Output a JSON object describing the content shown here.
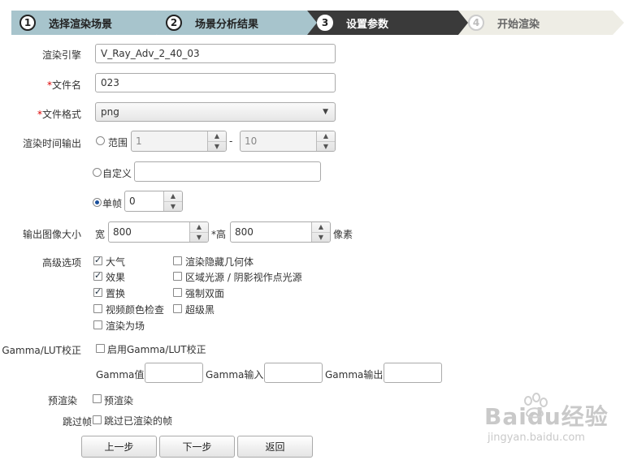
{
  "steps": [
    {
      "num": "1",
      "label": "选择渲染场景"
    },
    {
      "num": "2",
      "label": "场景分析结果"
    },
    {
      "num": "3",
      "label": "设置参数"
    },
    {
      "num": "4",
      "label": "开始渲染"
    }
  ],
  "form": {
    "engine_label": "渲染引擎",
    "engine_value": "V_Ray_Adv_2_40_03",
    "filename_label": "文件名",
    "filename_value": "023",
    "format_label": "文件格式",
    "format_value": "png",
    "time_label": "渲染时间输出",
    "range_label": "范围",
    "range_start": "1",
    "range_sep": "-",
    "range_end": "10",
    "custom_label": "自定义",
    "custom_value": "",
    "single_label": "单帧",
    "single_value": "0",
    "size_label": "输出图像大小",
    "width_label": "宽",
    "width_value": "800",
    "height_label": "*高",
    "height_value": "800",
    "pixel_label": "像素",
    "advanced_label": "高级选项",
    "advanced_left": [
      {
        "label": "大气",
        "checked": true
      },
      {
        "label": "效果",
        "checked": true
      },
      {
        "label": "置换",
        "checked": true
      },
      {
        "label": "视频颜色检查",
        "checked": false
      },
      {
        "label": "渲染为场",
        "checked": false
      }
    ],
    "advanced_right": [
      {
        "label": "渲染隐藏几何体",
        "checked": false
      },
      {
        "label": "区域光源 / 阴影视作点光源",
        "checked": false
      },
      {
        "label": "强制双面",
        "checked": false
      },
      {
        "label": "超级黑",
        "checked": false
      }
    ],
    "gamma_label": "Gamma/LUT校正",
    "gamma_enable_label": "启用Gamma/LUT校正",
    "gamma_value_label": "Gamma值",
    "gamma_in_label": "Gamma输入",
    "gamma_out_label": "Gamma输出",
    "prerender_label": "预渲染",
    "prerender_check_label": "预渲染",
    "skip_label": "跳过帧",
    "skip_check_label": "跳过已渲染的帧"
  },
  "buttons": {
    "prev": "上一步",
    "next": "下一步",
    "back": "返回"
  },
  "watermark": {
    "brand": "Baidu经验",
    "url": "jingyan.baidu.com"
  }
}
